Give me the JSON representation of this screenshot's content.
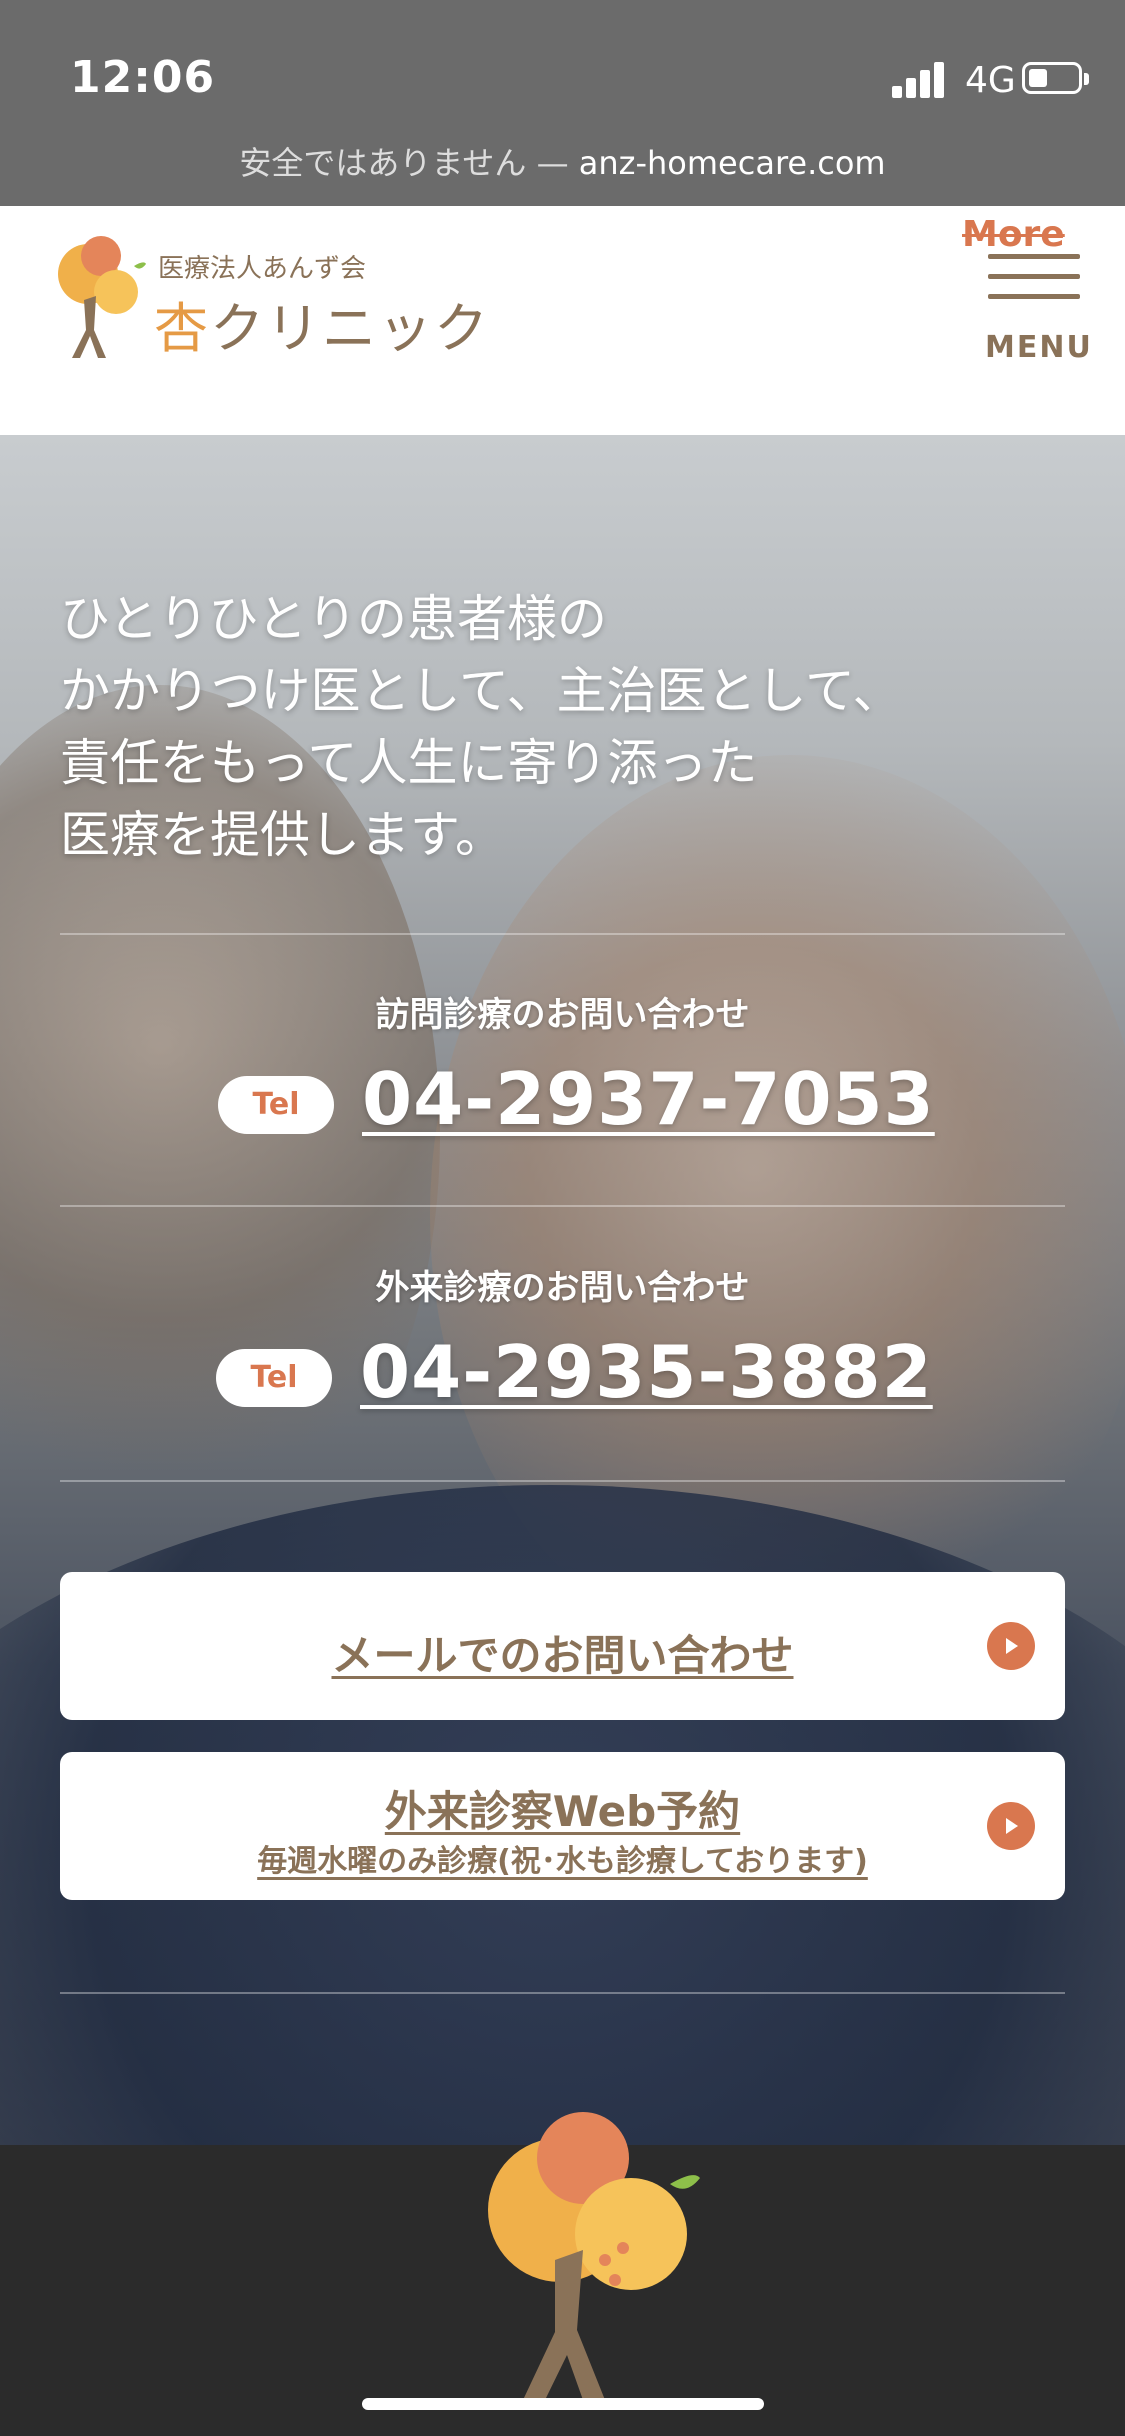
{
  "status_bar": {
    "time": "12:06",
    "network": "4G"
  },
  "browser": {
    "insecure_label": "安全ではありません —",
    "domain": "anz-homecare.com"
  },
  "header": {
    "org_name": "医療法人あんず会",
    "clinic_name_kanji": "杏",
    "clinic_name_rest": "クリニック",
    "more_label": "More",
    "menu_label": "MENU"
  },
  "hero": {
    "tagline": [
      "ひとりひとりの患者様の",
      "かかりつけ医として、主治医として、",
      "責任をもって人生に寄り添った",
      "医療を提供します。"
    ],
    "contacts": [
      {
        "label": "訪問診療のお問い合わせ",
        "tel_badge": "Tel",
        "phone": "04-2937-7053"
      },
      {
        "label": "外来診療のお問い合わせ",
        "tel_badge": "Tel",
        "phone": "04-2935-3882"
      }
    ],
    "buttons": {
      "mail": "メールでのお問い合わせ",
      "web_reserve": "外来診察Web予約",
      "web_reserve_note": "毎週水曜のみ診療(祝･水も診療しております)"
    }
  },
  "colors": {
    "accent": "#d9774f",
    "brand_brown": "#8a7258",
    "logo_orange": "#e59a45"
  }
}
